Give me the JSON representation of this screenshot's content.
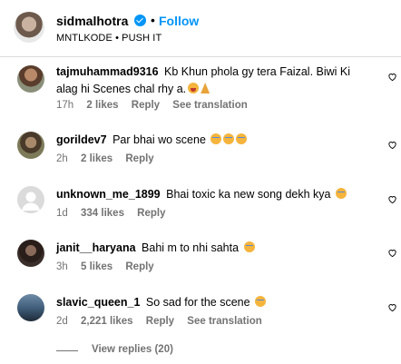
{
  "post": {
    "username": "sidmalhotra",
    "follow_label": "Follow",
    "dot": "•",
    "subtitle": "MNTLKODE • PUSH IT"
  },
  "comments": [
    {
      "user": "tajmuhammad9316",
      "text": "Kb Khun phola gy tera Faizal. Biwi Ki alag hi Scenes chal rhy a.",
      "time": "17h",
      "likes": "2 likes",
      "reply": "Reply",
      "translation": "See translation"
    },
    {
      "user": "gorildev7",
      "text": "Par bhai wo scene",
      "time": "2h",
      "likes": "2 likes",
      "reply": "Reply"
    },
    {
      "user": "unknown_me_1899",
      "text": "Bhai toxic ka new song dekh kya",
      "time": "1d",
      "likes": "334 likes",
      "reply": "Reply"
    },
    {
      "user": "janit__haryana",
      "text": "Bahi m to nhi sahta",
      "time": "3h",
      "likes": "5 likes",
      "reply": "Reply"
    },
    {
      "user": "slavic_queen_1",
      "text": "So sad for the scene",
      "time": "2d",
      "likes": "2,221 likes",
      "reply": "Reply",
      "translation": "See translation"
    }
  ],
  "view_replies": "View replies (20)",
  "colors": {
    "accent": "#0095f6",
    "meta_text": "#737373",
    "divider": "#dbdbdb"
  }
}
